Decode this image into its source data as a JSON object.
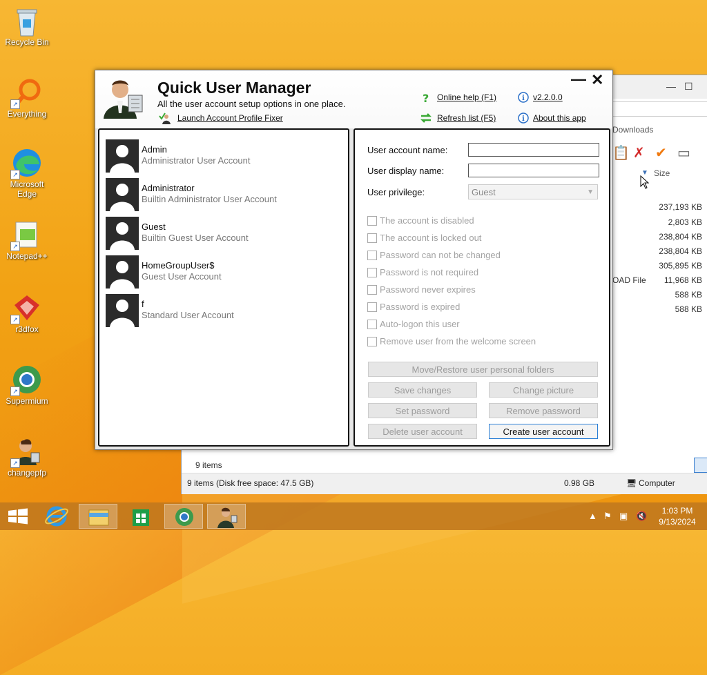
{
  "desktop": {
    "icons": [
      {
        "label": "Recycle Bin"
      },
      {
        "label": "Everything"
      },
      {
        "label": "Microsoft Edge"
      },
      {
        "label": "Notepad++"
      },
      {
        "label": "r3dfox"
      },
      {
        "label": "Supermium"
      },
      {
        "label": "changepfp"
      }
    ]
  },
  "explorer": {
    "breadcrumb_fragment": "Downloads",
    "column_size": "Size",
    "rows": [
      {
        "type": "",
        "size": "237,193 KB"
      },
      {
        "type": "",
        "size": "2,803 KB"
      },
      {
        "type": "",
        "size": "238,804 KB"
      },
      {
        "type": "",
        "size": "238,804 KB"
      },
      {
        "type": "",
        "size": "305,895 KB"
      },
      {
        "type": "OAD File",
        "size": "11,968 KB"
      },
      {
        "type": "",
        "size": "588 KB"
      },
      {
        "type": "",
        "size": "588 KB"
      }
    ],
    "items_count": "9 items",
    "status_left": "9 items (Disk free space: 47.5 GB)",
    "status_mid": "0.98 GB",
    "status_right": "Computer"
  },
  "app": {
    "title": "Quick User Manager",
    "subtitle": "All the user account setup options in one place.",
    "link_fixer": "Launch Account Profile Fixer",
    "link_help": "Online help (F1)",
    "link_refresh": "Refresh list (F5)",
    "link_version": "v2.2.0.0",
    "link_about": "About this app",
    "minimize": "—",
    "close": "✕",
    "users": [
      {
        "name": "Admin",
        "desc": "Administrator User Account"
      },
      {
        "name": "Administrator",
        "desc": "Builtin Administrator User Account"
      },
      {
        "name": "Guest",
        "desc": "Builtin Guest User Account"
      },
      {
        "name": "HomeGroupUser$",
        "desc": "Guest User Account"
      },
      {
        "name": "f",
        "desc": "Standard User Account"
      }
    ],
    "form": {
      "account_name_label": "User account name:",
      "account_name_value": "",
      "display_name_label": "User display name:",
      "display_name_value": "",
      "privilege_label": "User privilege:",
      "privilege_value": "Guest"
    },
    "checkboxes": [
      {
        "label": "The account is disabled",
        "checked": false
      },
      {
        "label": "The account is locked out",
        "checked": false
      },
      {
        "label": "Password can not be changed",
        "checked": false
      },
      {
        "label": "Password is not required",
        "checked": false
      },
      {
        "label": "Password never expires",
        "checked": false
      },
      {
        "label": "Password is expired",
        "checked": false
      },
      {
        "label": "Auto-logon this user",
        "checked": false
      },
      {
        "label": "Remove user from the welcome screen",
        "checked": false
      }
    ],
    "buttons": {
      "move_restore": "Move/Restore user personal folders",
      "save": "Save changes",
      "change_picture": "Change picture",
      "set_password": "Set password",
      "remove_password": "Remove password",
      "delete": "Delete user account",
      "create": "Create user account"
    }
  },
  "taskbar": {
    "time": "1:03 PM",
    "date": "9/13/2024"
  },
  "colors": {
    "accent_button_border": "#2a7fd6",
    "desktop_orange": "#f2a214",
    "help_green": "#3aa935",
    "info_blue": "#2a6fc8"
  }
}
